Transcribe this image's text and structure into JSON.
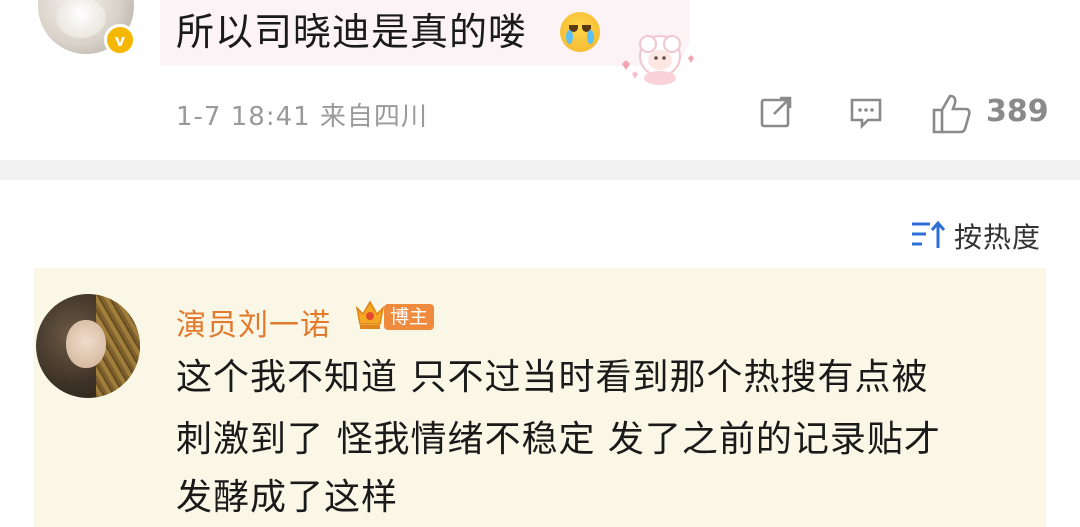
{
  "top_comment": {
    "text": "所以司晓迪是真的喽",
    "emoji_icon": "crying-face-icon",
    "sticker_icon": "sheep-sticker-icon",
    "meta": "1-7 18:41  来自四川",
    "like_count": "389"
  },
  "sort": {
    "label": "按热度",
    "icon": "sort-icon"
  },
  "author_reply": {
    "name": "演员刘一诺",
    "owner_tag": "博主",
    "lines": [
      "这个我不知道 只不过当时看到那个热搜有点被",
      "刺激到了 怪我情绪不稳定 发了之前的记录贴才",
      "发酵成了这样"
    ]
  },
  "colors": {
    "author_name": "#e27a2d",
    "reply_background": "#fbf7e6",
    "comment_bubble": "#fbf3f5",
    "separator": "#f1f1f1",
    "meta_text": "#9a9a9a"
  }
}
